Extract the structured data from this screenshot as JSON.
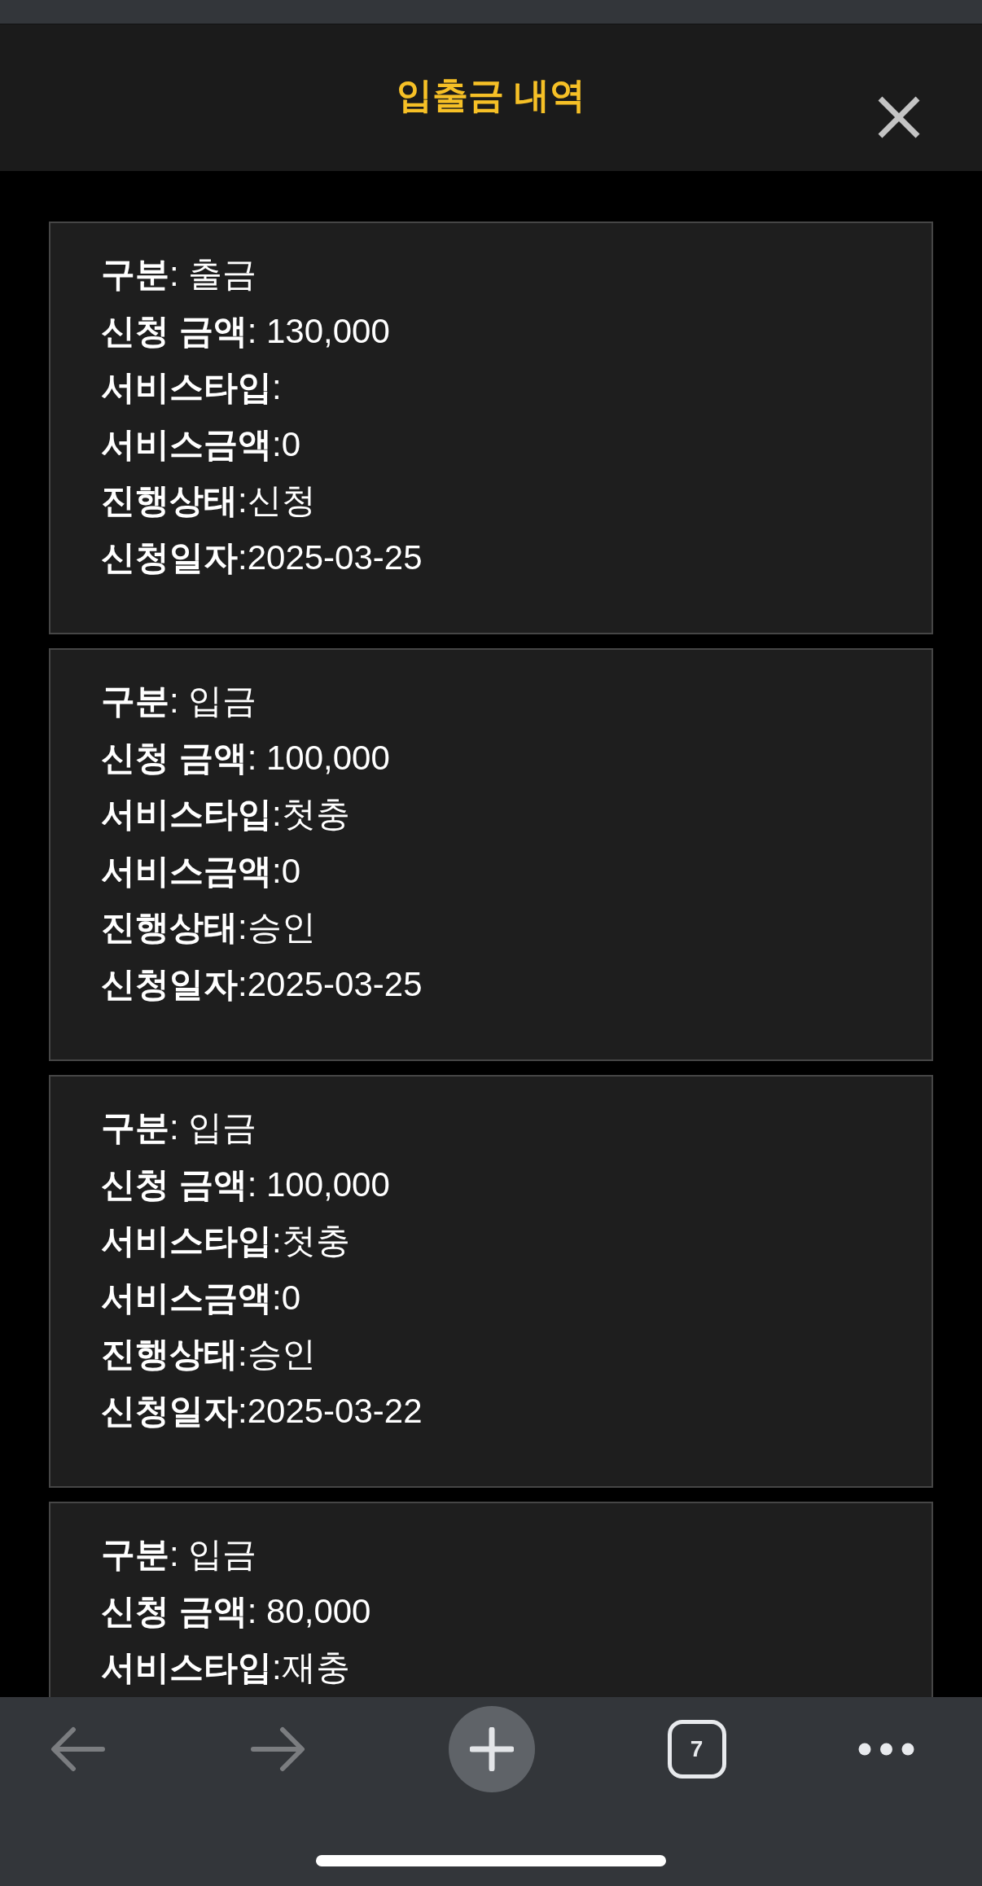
{
  "title": "입출금 내역",
  "records": [
    {
      "lines": [
        "**구분**: 출금",
        "**신청 금액**: 130,000",
        "**서비스타입**:",
        "**서비스금액**:0",
        "**진행상태**:신청",
        "**신청일자**:2025-03-25"
      ]
    },
    {
      "lines": [
        "**구분**: 입금",
        "**신청 금액**: 100,000",
        "**서비스타입**:첫충",
        "**서비스금액**:0",
        "**진행상태**:승인",
        "**신청일자**:2025-03-25"
      ]
    },
    {
      "lines": [
        "**구분**: 입금",
        "**신청 금액**: 100,000",
        "**서비스타입**:첫충",
        "**서비스금액**:0",
        "**진행상태**:승인",
        "**신청일자**:2025-03-22"
      ]
    },
    {
      "lines": [
        "**구분**: 입금",
        "**신청 금액**: 80,000",
        "**서비스타입**:재충"
      ]
    }
  ],
  "toolbar": {
    "back": {
      "disabled": true
    },
    "forward": {
      "disabled": true
    },
    "tab_count": "7"
  }
}
